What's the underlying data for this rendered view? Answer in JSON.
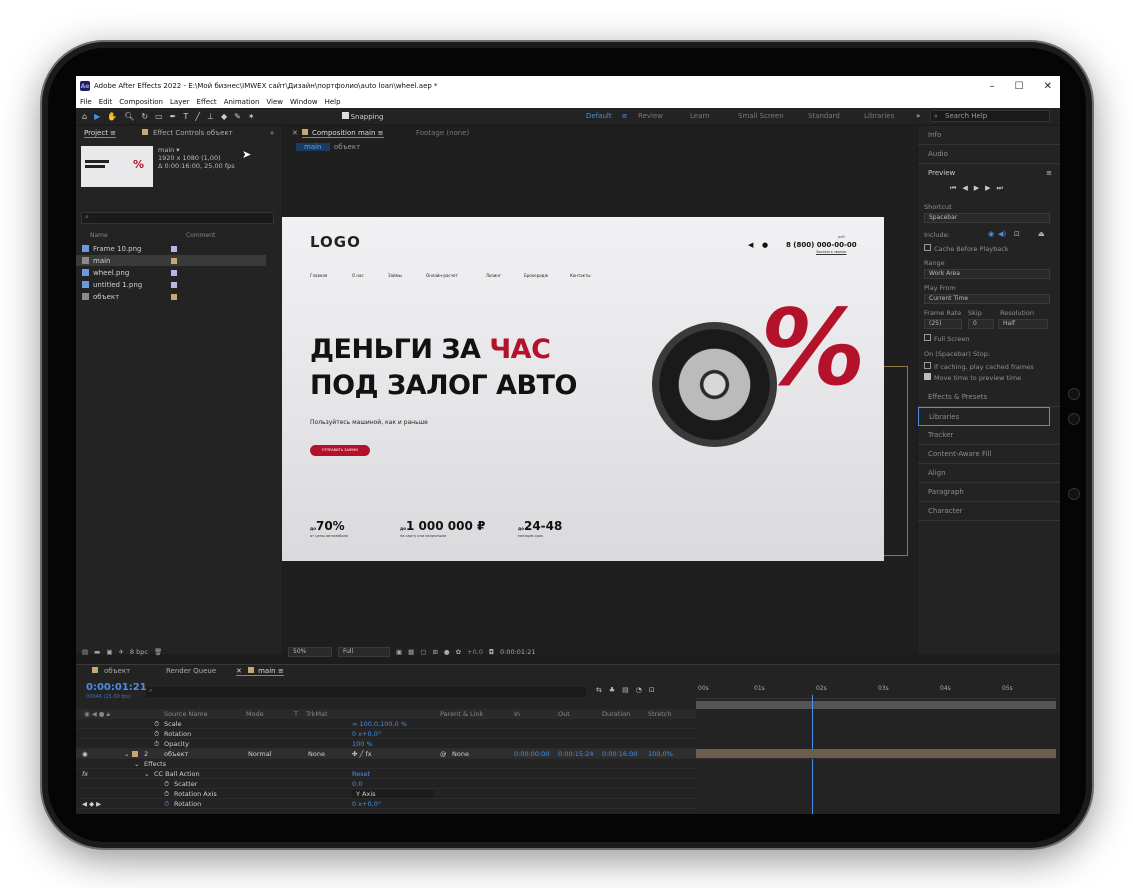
{
  "app": {
    "title": "Adobe After Effects 2022 - E:\\Мой бизнес\\IMWEX сайт\\Дизайн\\портфолио\\auto loan\\wheel.aep *",
    "min": "–",
    "max": "☐",
    "close": "✕"
  },
  "menu": [
    "File",
    "Edit",
    "Composition",
    "Layer",
    "Effect",
    "Animation",
    "View",
    "Window",
    "Help"
  ],
  "toolbar": {
    "snapping": "Snapping"
  },
  "workspaces": {
    "default": "Default",
    "review": "Review",
    "learn": "Learn",
    "small": "Small Screen",
    "standard": "Standard",
    "libraries": "Libraries",
    "more": "»"
  },
  "search": {
    "placeholder": "Search Help"
  },
  "project": {
    "tab": "Project",
    "fx_tab": "Effect Controls объект",
    "expand": "»",
    "thumb_name": "main ▾",
    "thumb_size": "1920 x 1080 (1,00)",
    "thumb_dur": "Δ 0:00:16:00, 25,00 fps",
    "col_name": "Name",
    "col_comment": "Comment",
    "bpc": "8 bpc",
    "items": [
      {
        "name": "Frame 10.png",
        "type": "file",
        "color": "#b5b5e8"
      },
      {
        "name": "main",
        "type": "comp",
        "color": "#c7a774"
      },
      {
        "name": "wheel.png",
        "type": "file",
        "color": "#b5b5e8"
      },
      {
        "name": "untitled 1.png",
        "type": "file",
        "color": "#b5b5e8"
      },
      {
        "name": "объект",
        "type": "comp",
        "color": "#c7a774"
      }
    ]
  },
  "comp": {
    "tab": "Composition main",
    "footage": "Footage (none)",
    "crumb_main": "main",
    "crumb_obj": "объект",
    "zoom": "50%",
    "res": "Full",
    "exposure": "+0,0",
    "time": "0:00:01:21"
  },
  "site": {
    "logo": "LOGO",
    "phone": "8 (800) 000-00-00",
    "phone_note": "рей",
    "callback": "Заказать звонок",
    "nav": [
      "Главная",
      "О нас",
      "Займы",
      "Онлайн-расчет",
      "Лизинг",
      "Брокеридж",
      "Контакты"
    ],
    "h1a": "ДЕНЬГИ ЗА ",
    "h1b": "ЧАС",
    "h2": "ПОД ЗАЛОГ АВТО",
    "sub": "Пользуйтесь машиной, как и раньше",
    "cta": "ОТПРАВИТЬ ЗАЯВКУ",
    "pct": "%",
    "stats": [
      {
        "pre": "до",
        "val": "70%",
        "label": "от цены автомобиля"
      },
      {
        "pre": "до",
        "val": "1 000 000 ₽",
        "label": "на карту или наличными"
      },
      {
        "pre": "до",
        "val": "24-48",
        "label": "месяцев срок"
      }
    ],
    "accent": "#b3122a"
  },
  "right": {
    "info": "Info",
    "audio": "Audio",
    "preview": "Preview",
    "shortcut": "Shortcut",
    "spacebar": "Spacebar",
    "include": "Include:",
    "cache": "Cache Before Playback",
    "range": "Range",
    "work_area": "Work Area",
    "play_from": "Play From",
    "current_time": "Current Time",
    "frame_rate": "Frame Rate",
    "skip": "Skip",
    "resolution": "Resolution",
    "fr_val": "(25)",
    "skip_val": "0",
    "res_val": "Half",
    "fullscreen": "Full Screen",
    "on_stop": "On (Spacebar) Stop:",
    "if_caching": "If caching, play cached frames",
    "move_time": "Move time to preview time",
    "panels": [
      "Effects & Presets",
      "Libraries",
      "Tracker",
      "Content-Aware Fill",
      "Align",
      "Paragraph",
      "Character"
    ]
  },
  "timeline": {
    "tab_obj": "объект",
    "tab_rq": "Render Queue",
    "tab_main": "main",
    "timecode": "0:00:01:21",
    "timecode_sub": "00046 (25.00 fps)",
    "cols": [
      "Source Name",
      "Mode",
      "T",
      "TrkMat",
      "Parent & Link",
      "In",
      "Out",
      "Duration",
      "Stretch"
    ],
    "ruler": [
      "00s",
      "01s",
      "02s",
      "03s",
      "04s",
      "05s"
    ],
    "rows": [
      {
        "name": "Scale",
        "value": "∞ 100,0,100,0 %"
      },
      {
        "name": "Rotation",
        "value": "0 x+0,0°"
      },
      {
        "name": "Opacity",
        "value": "100 %"
      }
    ],
    "layer": {
      "num": "2",
      "name": "объект",
      "mode": "Normal",
      "trk": "None",
      "parent": "None",
      "in": "0:00:00:00",
      "out": "0:00:15:24",
      "dur": "0:00:16:00",
      "stretch": "100,0%"
    },
    "effects": "Effects",
    "effect_name": "CC Ball Action",
    "reset": "Reset",
    "fx_rows": [
      {
        "name": "Scatter",
        "value": "0,0"
      },
      {
        "name": "Rotation Axis",
        "value": "Y Axis"
      },
      {
        "name": "Rotation",
        "value": "0 x+0,0°"
      }
    ]
  }
}
